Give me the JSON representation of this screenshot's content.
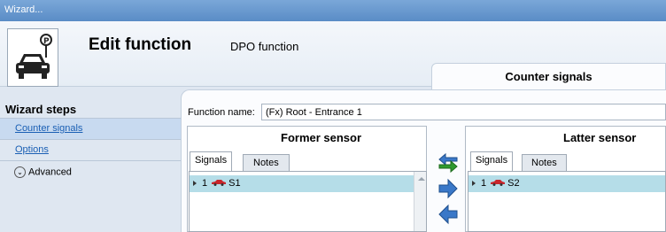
{
  "window": {
    "title": "Wizard..."
  },
  "header": {
    "title": "Edit function",
    "subtitle": "DPO function"
  },
  "step_tab": {
    "label": "Counter signals"
  },
  "sidebar": {
    "heading": "Wizard steps",
    "items": [
      {
        "label": "Counter signals",
        "active": true
      },
      {
        "label": "Options",
        "active": false
      }
    ],
    "advanced": {
      "label": "Advanced"
    }
  },
  "function_name": {
    "label": "Function name:",
    "value": "(Fx) Root - Entrance 1"
  },
  "former": {
    "title": "Former sensor",
    "tabs": [
      "Signals",
      "Notes"
    ],
    "rows": [
      {
        "index": "1",
        "name": "S1"
      }
    ]
  },
  "latter": {
    "title": "Latter sensor",
    "tabs": [
      "Signals",
      "Notes"
    ],
    "rows": [
      {
        "index": "1",
        "name": "S2"
      }
    ]
  },
  "colors": {
    "row_highlight": "#b5dde8",
    "link": "#1a5fb4",
    "arrow_green": "#2e9a2e",
    "arrow_blue": "#3a78c8"
  }
}
